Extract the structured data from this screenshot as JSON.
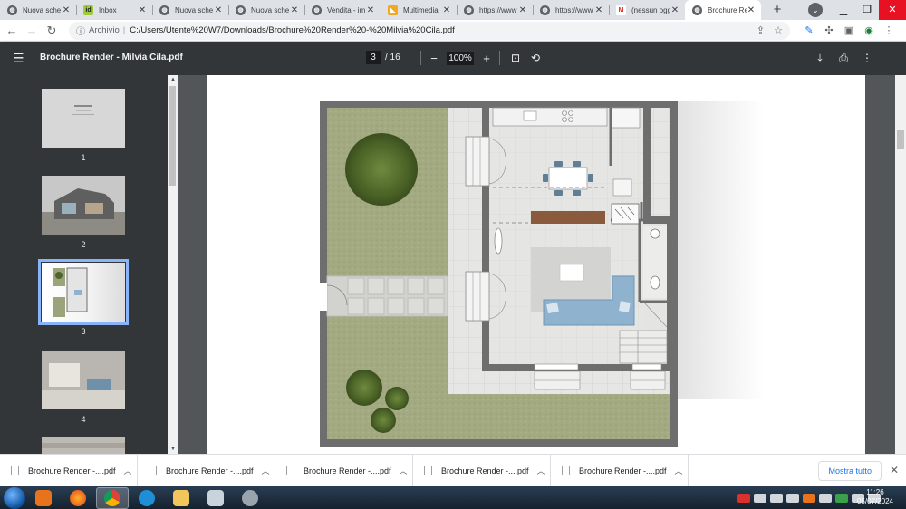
{
  "browser": {
    "tabs": [
      {
        "title": "Nuova sche",
        "icon": "globe-icon",
        "active": false
      },
      {
        "title": "Inbox",
        "icon": "id-icon",
        "active": false
      },
      {
        "title": "Nuova sche",
        "icon": "globe-icon",
        "active": false
      },
      {
        "title": "Nuova sche",
        "icon": "globe-icon",
        "active": false
      },
      {
        "title": "Vendita - im",
        "icon": "globe-icon",
        "active": false
      },
      {
        "title": "Multimedia",
        "icon": "multimedia-icon",
        "active": false
      },
      {
        "title": "https://www",
        "icon": "globe-icon",
        "active": false
      },
      {
        "title": "https://www",
        "icon": "globe-icon",
        "active": false
      },
      {
        "title": "(nessun ogg",
        "icon": "gmail-icon",
        "active": false
      },
      {
        "title": "Brochure Re",
        "icon": "globe-icon",
        "active": true
      }
    ],
    "address": {
      "label": "Archivio",
      "url": "C:/Users/Utente%20W7/Downloads/Brochure%20Render%20-%20Milvia%20Cila.pdf"
    }
  },
  "pdf": {
    "title": "Brochure Render - Milvia Cila.pdf",
    "current_page": "3",
    "total_pages": "/ 16",
    "zoom": "100%",
    "thumbnails": [
      {
        "number": "1",
        "selected": false
      },
      {
        "number": "2",
        "selected": false
      },
      {
        "number": "3",
        "selected": true
      },
      {
        "number": "4",
        "selected": false
      }
    ]
  },
  "downloads": {
    "items": [
      "Brochure Render -....pdf",
      "Brochure Render -....pdf",
      "Brochure Render -....pdf",
      "Brochure Render -....pdf",
      "Brochure Render -....pdf"
    ],
    "show_all": "Mostra tutto"
  },
  "taskbar": {
    "time": "11:26",
    "date": "05/07/2024"
  },
  "colors": {
    "toolbar": "#323639",
    "doc_bg": "#525659",
    "selection": "#8ab4f8",
    "lawn": "#9aa37a",
    "wall": "#6e6e6e",
    "sofa": "#8fb3cf"
  }
}
